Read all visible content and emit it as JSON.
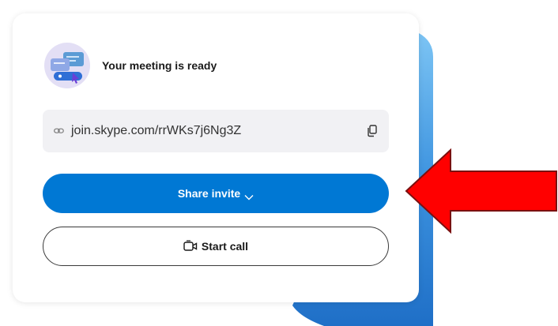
{
  "meeting": {
    "title": "Your meeting is ready",
    "link": "join.skype.com/rrWKs7j6Ng3Z"
  },
  "actions": {
    "share_label": "Share invite",
    "call_label": "Start call"
  },
  "colors": {
    "primary": "#0078d4",
    "arrow": "#ff0000"
  },
  "icons": {
    "avatar": "meeting-illustration-icon",
    "link": "link-icon",
    "copy": "copy-icon",
    "share_dropdown": "chevron-down-icon",
    "call": "video-camera-icon"
  }
}
